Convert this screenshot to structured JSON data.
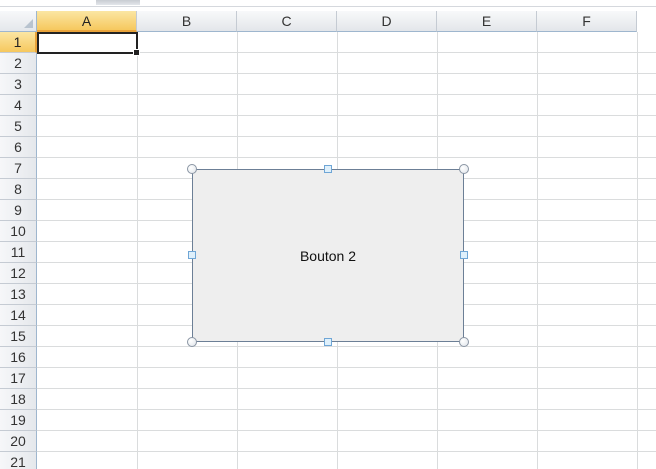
{
  "columns": [
    "A",
    "B",
    "C",
    "D",
    "E",
    "F"
  ],
  "rows": [
    "1",
    "2",
    "3",
    "4",
    "5",
    "6",
    "7",
    "8",
    "9",
    "10",
    "11",
    "12",
    "13",
    "14",
    "15",
    "16",
    "17",
    "18",
    "19",
    "20",
    "21"
  ],
  "selected_cell": {
    "column": "A",
    "row": "1"
  },
  "form_button": {
    "label": "Bouton 2"
  },
  "colors": {
    "selected_header": "#f6c85e",
    "gridline": "#dadcdd",
    "header_border": "#9eb6ce",
    "button_fill": "#eeeeee"
  }
}
